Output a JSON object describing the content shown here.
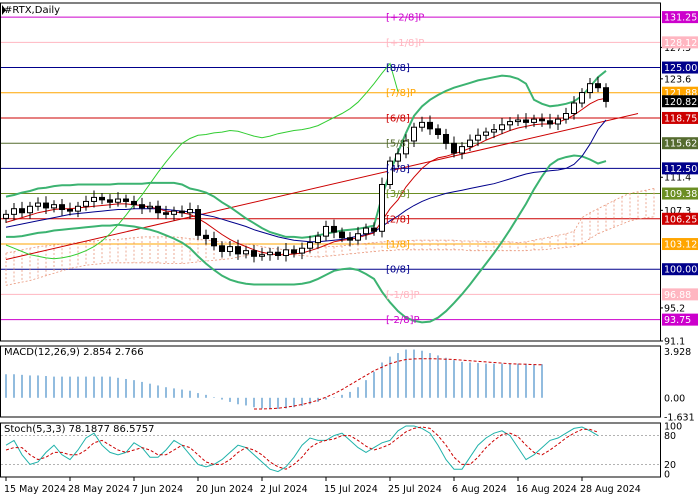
{
  "colors": {
    "bullish_candle": "#ffffff",
    "bearish_candle": "#000000",
    "bollinger": "#3cb371",
    "ma_fast": "#cc0000",
    "ma_slow": "#00008b",
    "envelope": "#32cd32",
    "trendline": "#cc0000",
    "ichimoku_cloud": "#e9967a",
    "macd_hist": "#4a8fc9",
    "macd_signal": "#cc0000",
    "stoch_main": "#20b2aa",
    "stoch_signal": "#cc0000",
    "last_price_tag": "#000000",
    "murray_plus_2": "#cc00cc",
    "murray_plus_1": "#ffb6c1",
    "murray_8_8": "#00008b",
    "murray_7_8": "#ffa500",
    "murray_6_8": "#cc0000",
    "murray_5_8": "#556b2f",
    "murray_4_8": "#00008b",
    "murray_3_8": "#6b8e23",
    "murray_2_8": "#cc0000",
    "murray_1_8": "#ffa500",
    "murray_0_8": "#00008b",
    "murray_minus_1": "#ffb6c1",
    "murray_minus_2": "#cc00cc"
  },
  "chart_data": {
    "type": "candlestick",
    "title": "#RTX,Daily",
    "symbol": "#RTX",
    "timeframe": "Daily",
    "ylim": [
      91.1,
      133.0
    ],
    "price_ticks": [
      127.5,
      123.6,
      111.4,
      107.3,
      95.2,
      91.1
    ],
    "last_price": 120.82,
    "x_labels": [
      {
        "label": "15 May 2024",
        "index": 0
      },
      {
        "label": "28 May 2024",
        "index": 8
      },
      {
        "label": "7 Jun 2024",
        "index": 16
      },
      {
        "label": "20 Jun 2024",
        "index": 24
      },
      {
        "label": "2 Jul 2024",
        "index": 32
      },
      {
        "label": "15 Jul 2024",
        "index": 40
      },
      {
        "label": "25 Jul 2024",
        "index": 48
      },
      {
        "label": "6 Aug 2024",
        "index": 56
      },
      {
        "label": "16 Aug 2024",
        "index": 64
      },
      {
        "label": "28 Aug 2024",
        "index": 72
      }
    ],
    "murray_levels": [
      {
        "label": "[+2/8]P",
        "price": 131.25,
        "color_key": "murray_plus_2"
      },
      {
        "label": "[+1/8]P",
        "price": 128.12,
        "color_key": "murray_plus_1"
      },
      {
        "label": "[8/8]",
        "price": 125.0,
        "color_key": "murray_8_8"
      },
      {
        "label": "[7/8]P",
        "price": 121.88,
        "color_key": "murray_7_8"
      },
      {
        "label": "[6/8]",
        "price": 118.75,
        "color_key": "murray_6_8"
      },
      {
        "label": "[5/8]",
        "price": 115.62,
        "color_key": "murray_5_8"
      },
      {
        "label": "[4/8]",
        "price": 112.5,
        "color_key": "murray_4_8"
      },
      {
        "label": "[3/8]",
        "price": 109.38,
        "color_key": "murray_3_8"
      },
      {
        "label": "[2/8]",
        "price": 106.25,
        "color_key": "murray_2_8"
      },
      {
        "label": "[1/8]",
        "price": 103.12,
        "color_key": "murray_1_8"
      },
      {
        "label": "[0/8]",
        "price": 100.0,
        "color_key": "murray_0_8"
      },
      {
        "label": "[-1/8]P",
        "price": 96.88,
        "color_key": "murray_minus_1"
      },
      {
        "label": "[-2/8]P",
        "price": 93.75,
        "color_key": "murray_minus_2"
      }
    ],
    "level_tags": [
      {
        "text": "131.25",
        "price": 131.25,
        "color_key": "murray_plus_2"
      },
      {
        "text": "128.12",
        "price": 128.12,
        "color_key": "murray_plus_1"
      },
      {
        "text": "125.00",
        "price": 125.0,
        "color_key": "murray_8_8"
      },
      {
        "text": "121.88",
        "price": 121.88,
        "color_key": "murray_7_8"
      },
      {
        "text": "120.82",
        "price": 120.82,
        "color_key": "last_price_tag"
      },
      {
        "text": "118.75",
        "price": 118.75,
        "color_key": "murray_6_8"
      },
      {
        "text": "115.62",
        "price": 115.62,
        "color_key": "murray_5_8"
      },
      {
        "text": "112.50",
        "price": 112.5,
        "color_key": "murray_4_8"
      },
      {
        "text": "109.38",
        "price": 109.38,
        "color_key": "murray_3_8"
      },
      {
        "text": "106.25",
        "price": 106.25,
        "color_key": "murray_2_8"
      },
      {
        "text": "103.12",
        "price": 103.12,
        "color_key": "murray_1_8"
      },
      {
        "text": "100.00",
        "price": 100.0,
        "color_key": "murray_0_8"
      },
      {
        "text": "96.88",
        "price": 96.88,
        "color_key": "murray_minus_1"
      },
      {
        "text": "93.75",
        "price": 93.75,
        "color_key": "murray_minus_2"
      }
    ],
    "closes": [
      106.8,
      107.5,
      107.0,
      107.8,
      108.2,
      107.6,
      108.0,
      107.4,
      107.2,
      107.8,
      108.4,
      108.9,
      108.6,
      108.3,
      108.7,
      108.4,
      108.0,
      107.6,
      107.8,
      107.0,
      106.8,
      107.2,
      107.0,
      107.4,
      104.2,
      103.8,
      102.9,
      102.2,
      102.8,
      101.9,
      102.3,
      101.6,
      101.8,
      102.1,
      101.7,
      102.4,
      102.0,
      102.6,
      103.3,
      104.1,
      105.3,
      104.6,
      103.9,
      103.6,
      104.4,
      105.1,
      104.7,
      110.5,
      113.4,
      114.3,
      115.9,
      117.6,
      118.2,
      117.4,
      116.7,
      115.6,
      114.4,
      115.2,
      116.0,
      116.6,
      117.0,
      117.3,
      117.9,
      118.3,
      118.5,
      118.2,
      118.6,
      118.4,
      118.0,
      118.6,
      119.3,
      120.6,
      121.9,
      123.0,
      122.5,
      120.8
    ],
    "bb_upper": [
      109.0,
      109.2,
      109.5,
      109.7,
      110.0,
      110.1,
      110.3,
      110.4,
      110.4,
      110.5,
      110.5,
      110.5,
      110.5,
      110.5,
      110.6,
      110.6,
      110.6,
      110.6,
      110.7,
      110.7,
      110.7,
      110.7,
      110.5,
      110.0,
      109.8,
      109.5,
      109.0,
      108.3,
      107.7,
      107.0,
      106.3,
      105.7,
      105.1,
      104.6,
      104.3,
      104.0,
      104.0,
      103.9,
      104.0,
      104.2,
      104.4,
      104.6,
      104.8,
      104.9,
      105.0,
      105.2,
      105.4,
      109.0,
      112.0,
      114.5,
      116.9,
      119.0,
      120.2,
      121.0,
      121.6,
      122.1,
      122.5,
      122.8,
      123.1,
      123.4,
      123.6,
      123.8,
      124.0,
      123.9,
      123.6,
      123.0,
      121.0,
      120.5,
      120.2,
      120.3,
      120.5,
      120.8,
      121.5,
      122.6,
      123.8,
      124.6
    ],
    "bb_lower": [
      104.0,
      104.0,
      104.1,
      104.3,
      104.5,
      104.6,
      104.8,
      104.9,
      105.0,
      105.1,
      105.2,
      105.3,
      105.4,
      105.4,
      105.5,
      105.4,
      105.3,
      105.1,
      104.9,
      104.6,
      104.2,
      103.8,
      103.3,
      102.6,
      101.6,
      100.7,
      99.9,
      99.2,
      98.7,
      98.4,
      98.2,
      98.1,
      98.1,
      98.1,
      98.1,
      98.1,
      98.1,
      98.2,
      98.4,
      98.8,
      99.3,
      99.8,
      100.0,
      100.1,
      99.9,
      99.4,
      98.8,
      97.2,
      95.9,
      94.8,
      94.0,
      93.6,
      93.4,
      93.5,
      94.0,
      94.8,
      95.8,
      96.9,
      98.1,
      99.4,
      100.7,
      102.0,
      103.4,
      104.9,
      106.5,
      108.1,
      109.9,
      111.5,
      112.9,
      113.6,
      113.9,
      114.1,
      114.0,
      113.6,
      113.1,
      113.4
    ],
    "ma_fast": [
      105.8,
      106.1,
      106.4,
      106.7,
      107.0,
      107.2,
      107.4,
      107.5,
      107.5,
      107.6,
      107.7,
      107.8,
      107.9,
      108.0,
      108.1,
      108.1,
      108.0,
      107.9,
      107.7,
      107.5,
      107.2,
      107.1,
      107.0,
      106.8,
      106.3,
      105.7,
      105.0,
      104.3,
      103.7,
      103.2,
      102.8,
      102.4,
      102.1,
      101.9,
      101.8,
      101.8,
      101.9,
      102.0,
      102.3,
      102.6,
      103.0,
      103.4,
      103.6,
      103.7,
      103.9,
      104.2,
      104.5,
      106.0,
      107.5,
      108.6,
      110.2,
      111.4,
      112.5,
      113.3,
      113.8,
      114.0,
      114.3,
      114.6,
      115.0,
      115.5,
      116.0,
      116.4,
      116.8,
      117.2,
      117.5,
      117.7,
      117.9,
      118.0,
      118.0,
      118.2,
      118.6,
      119.1,
      119.8,
      120.5,
      121.0,
      121.2
    ],
    "ma_slow": [
      105.2,
      105.4,
      105.6,
      105.8,
      106.0,
      106.2,
      106.4,
      106.6,
      106.8,
      106.9,
      107.0,
      107.1,
      107.2,
      107.3,
      107.4,
      107.4,
      107.5,
      107.5,
      107.5,
      107.5,
      107.4,
      107.3,
      107.2,
      107.1,
      106.9,
      106.7,
      106.5,
      106.2,
      105.9,
      105.6,
      105.3,
      104.9,
      104.6,
      104.3,
      104.0,
      103.8,
      103.6,
      103.5,
      103.4,
      103.4,
      103.5,
      103.6,
      103.7,
      103.9,
      104.1,
      104.3,
      104.6,
      105.3,
      106.0,
      106.6,
      107.3,
      107.9,
      108.4,
      108.8,
      109.1,
      109.4,
      109.6,
      109.8,
      110.0,
      110.2,
      110.4,
      110.6,
      110.9,
      111.2,
      111.5,
      111.8,
      112.0,
      112.1,
      112.2,
      112.3,
      112.5,
      113.0,
      114.0,
      115.5,
      117.3,
      118.5
    ],
    "envelope": [
      103.0,
      102.6,
      102.2,
      101.8,
      101.6,
      101.4,
      101.3,
      101.4,
      101.6,
      101.9,
      102.3,
      102.8,
      103.5,
      104.4,
      105.5,
      106.7,
      108.0,
      109.2,
      110.6,
      112.0,
      113.3,
      114.5,
      115.6,
      116.2,
      116.6,
      116.7,
      116.9,
      117.0,
      117.2,
      117.1,
      116.8,
      116.5,
      116.3,
      116.5,
      116.8,
      117.0,
      117.2,
      117.3,
      117.5,
      117.8,
      118.3,
      118.8,
      119.3,
      119.9,
      120.7,
      121.8,
      123.0,
      124.3,
      125.5,
      122.0
    ],
    "cloud_top": [
      102.0,
      102.2,
      102.4,
      102.6,
      102.8,
      102.9,
      103.0,
      103.1,
      103.2,
      103.3,
      103.4,
      103.5,
      103.6,
      103.7,
      103.7,
      103.8,
      103.9,
      104.0,
      104.0,
      104.0,
      104.0,
      104.0,
      103.9,
      103.8,
      103.7,
      103.6,
      103.5,
      103.4,
      103.3,
      103.2,
      103.1,
      103.0,
      102.8,
      102.6,
      102.5,
      102.4,
      102.4,
      102.5,
      102.6,
      102.7,
      102.8,
      102.8,
      102.9,
      103.0,
      103.1,
      103.2,
      103.3,
      103.4,
      103.4,
      103.5,
      103.5,
      103.6,
      103.6,
      103.6,
      103.6,
      103.6,
      103.6,
      103.5,
      103.5,
      103.5,
      103.4,
      103.4,
      103.4,
      103.4,
      103.3,
      103.4,
      103.6,
      103.8,
      104.0,
      104.2,
      104.4,
      104.7,
      106.4,
      107.0,
      107.5,
      108.0,
      108.5,
      109.0,
      109.4,
      109.6,
      109.8,
      110.0
    ],
    "cloud_bottom": [
      98.0,
      98.2,
      98.4,
      98.6,
      98.9,
      99.2,
      99.5,
      99.8,
      100.1,
      100.3,
      100.5,
      100.6,
      100.7,
      100.8,
      100.8,
      100.8,
      100.8,
      100.8,
      100.8,
      100.8,
      100.7,
      100.7,
      100.7,
      100.8,
      100.9,
      101.0,
      101.1,
      101.2,
      101.3,
      101.5,
      101.7,
      101.9,
      102.0,
      102.0,
      102.0,
      101.9,
      101.8,
      101.7,
      101.6,
      101.5,
      101.6,
      101.7,
      101.8,
      101.9,
      102.0,
      102.1,
      102.2,
      102.3,
      102.3,
      102.4,
      102.4,
      102.4,
      102.4,
      102.4,
      102.4,
      102.4,
      102.4,
      102.4,
      102.3,
      102.3,
      102.3,
      102.3,
      102.3,
      102.3,
      102.3,
      102.3,
      102.4,
      102.4,
      102.5,
      102.6,
      102.7,
      102.8,
      103.2,
      103.8,
      104.4,
      104.8,
      105.2,
      105.6,
      106.0,
      106.2,
      106.4,
      106.5
    ],
    "trendline": {
      "start_index": 0,
      "start_price": 101.2,
      "end_index": 79,
      "end_price": 119.3
    },
    "macd": {
      "label": "MACD(12,26,9) 2.854 2.766",
      "ylim": [
        -1.631,
        4.4
      ],
      "ticks": [
        {
          "text": "3.928",
          "value": 3.928
        },
        {
          "text": "0.00",
          "value": 0
        },
        {
          "text": "-1.631",
          "value": -1.631
        }
      ],
      "hist": [
        2.0,
        2.0,
        1.95,
        1.9,
        1.9,
        1.85,
        1.8,
        1.8,
        1.8,
        1.8,
        1.8,
        1.8,
        1.8,
        1.8,
        1.7,
        1.6,
        1.5,
        1.35,
        1.2,
        1.05,
        0.9,
        0.8,
        0.7,
        0.6,
        0.4,
        0.25,
        0.05,
        -0.15,
        -0.35,
        -0.55,
        -0.65,
        -0.8,
        -0.9,
        -0.95,
        -0.95,
        -0.9,
        -0.8,
        -0.7,
        -0.55,
        -0.35,
        -0.15,
        0.05,
        0.25,
        0.5,
        0.9,
        1.5,
        2.2,
        3.0,
        3.5,
        3.8,
        4.1,
        4.1,
        4.0,
        3.8,
        3.6,
        3.4,
        3.2,
        3.05,
        3.0,
        2.95,
        2.9,
        2.9,
        2.9,
        2.9,
        2.9,
        2.9,
        2.85,
        2.85
      ],
      "signal": [
        null,
        null,
        null,
        null,
        null,
        null,
        null,
        null,
        null,
        null,
        null,
        null,
        null,
        null,
        null,
        null,
        null,
        null,
        null,
        null,
        null,
        null,
        null,
        null,
        null,
        null,
        null,
        null,
        null,
        null,
        null,
        -0.95,
        -0.95,
        -0.93,
        -0.88,
        -0.8,
        -0.7,
        -0.57,
        -0.4,
        -0.2,
        0.05,
        0.35,
        0.7,
        1.1,
        1.5,
        1.9,
        2.3,
        2.6,
        2.9,
        3.1,
        3.25,
        3.3,
        3.32,
        3.32,
        3.3,
        3.28,
        3.25,
        3.2,
        3.15,
        3.1,
        3.05,
        3.0,
        2.95,
        2.9,
        2.87,
        2.85,
        2.82,
        2.8
      ]
    },
    "stoch": {
      "label": "Stoch(5,3,3) 78.1877 86.5757",
      "ylim": [
        0,
        100
      ],
      "ticks": [
        {
          "text": "100",
          "value": 100
        },
        {
          "text": "80",
          "value": 80
        },
        {
          "text": "20",
          "value": 20
        },
        {
          "text": "0",
          "value": 0
        }
      ],
      "levels": [
        80,
        20
      ],
      "main": [
        60,
        70,
        40,
        20,
        25,
        45,
        60,
        40,
        30,
        50,
        75,
        85,
        60,
        45,
        40,
        45,
        65,
        55,
        35,
        35,
        50,
        70,
        60,
        40,
        20,
        15,
        20,
        30,
        45,
        60,
        55,
        40,
        25,
        10,
        5,
        15,
        35,
        60,
        75,
        70,
        70,
        80,
        85,
        70,
        55,
        45,
        55,
        65,
        70,
        90,
        100,
        100,
        95,
        85,
        60,
        30,
        10,
        10,
        35,
        60,
        75,
        85,
        90,
        80,
        55,
        30,
        40,
        55,
        70,
        75,
        85,
        95,
        98,
        90,
        80
      ],
      "signal": [
        50,
        55,
        55,
        40,
        30,
        35,
        45,
        45,
        40,
        40,
        50,
        65,
        70,
        60,
        50,
        45,
        50,
        55,
        50,
        40,
        40,
        50,
        60,
        55,
        40,
        25,
        20,
        20,
        30,
        45,
        55,
        50,
        40,
        25,
        15,
        10,
        20,
        35,
        55,
        65,
        70,
        73,
        80,
        80,
        70,
        58,
        50,
        55,
        62,
        75,
        88,
        95,
        98,
        95,
        80,
        60,
        35,
        20,
        20,
        35,
        55,
        70,
        82,
        85,
        78,
        60,
        45,
        40,
        50,
        62,
        75,
        85,
        93,
        93,
        87
      ]
    }
  }
}
